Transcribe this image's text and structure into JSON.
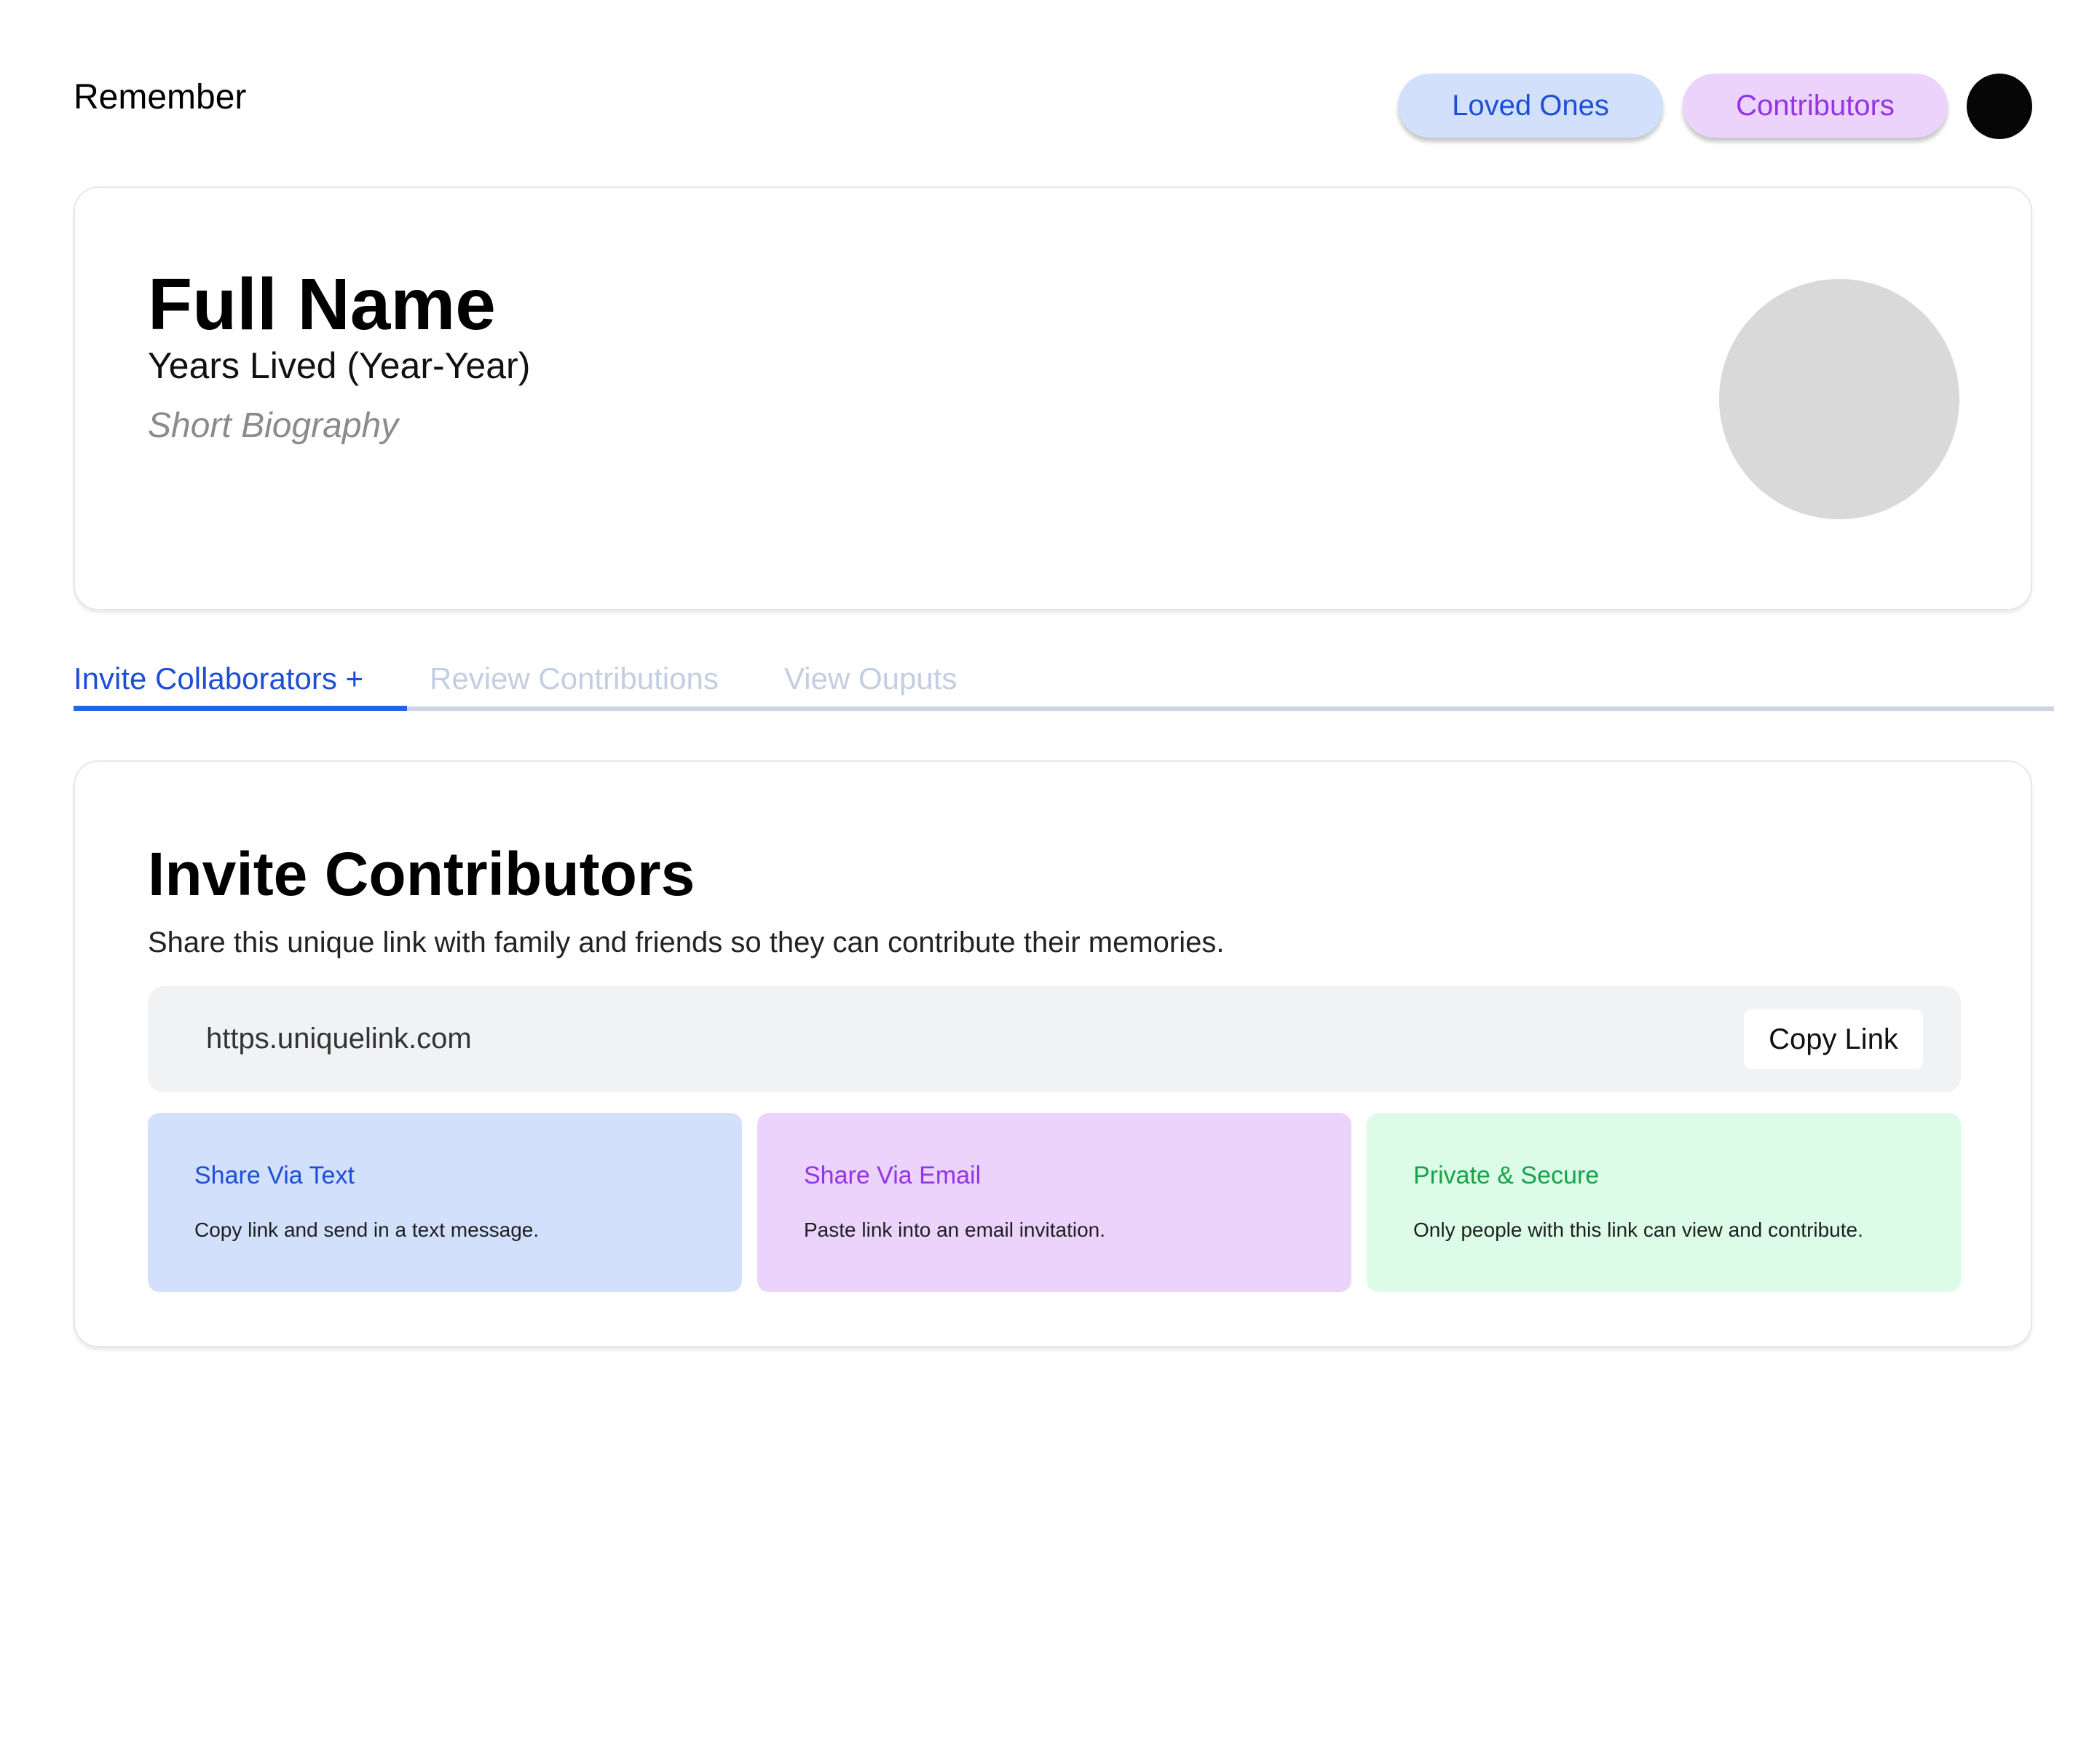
{
  "header": {
    "brand": "Remember",
    "nav": {
      "loved_ones": "Loved Ones",
      "contributors": "Contributors"
    }
  },
  "profile": {
    "full_name": "Full Name",
    "years_lived": "Years Lived (Year-Year)",
    "bio": "Short Biography"
  },
  "tabs": [
    {
      "label": "Invite Collaborators +",
      "active": true
    },
    {
      "label": "Review Contributions",
      "active": false
    },
    {
      "label": "View Ouputs",
      "active": false
    }
  ],
  "invite": {
    "title": "Invite Contributors",
    "description": "Share this unique link with family and friends so they can contribute their memories.",
    "link": "https.uniquelink.com",
    "copy_label": "Copy Link",
    "options": [
      {
        "title": "Share Via Text",
        "desc": "Copy link and send in a text message."
      },
      {
        "title": "Share Via Email",
        "desc": "Paste link into an email invitation."
      },
      {
        "title": "Private & Secure",
        "desc": "Only people with this link can view and contribute."
      }
    ]
  },
  "colors": {
    "accent_blue": "#1d4ed8",
    "accent_purple": "#9333ea",
    "accent_green": "#16a34a",
    "pill_blue_bg": "#d2e0fb",
    "pill_purple_bg": "#ecd3fb",
    "green_bg": "#dcfce7"
  }
}
